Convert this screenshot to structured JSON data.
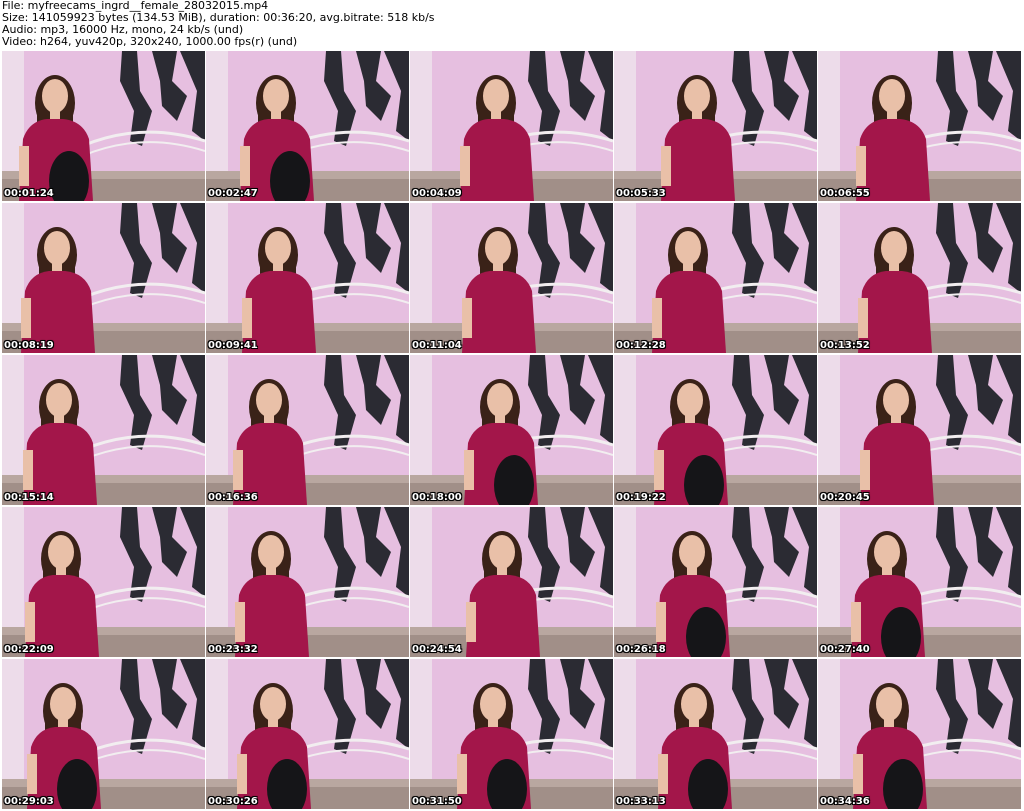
{
  "header": {
    "file": "File: myfreecams_ingrd__female_28032015.mp4",
    "size": "Size: 141059923 bytes (134.53 MiB), duration: 00:36:20, avg.bitrate: 518 kb/s",
    "audio": "Audio: mp3, 16000 Hz, mono, 24 kb/s (und)",
    "video": "Video: h264, yuv420p, 320x240, 1000.00 fps(r) (und)"
  },
  "frames": [
    {
      "timestamp": "00:01:24"
    },
    {
      "timestamp": "00:02:47"
    },
    {
      "timestamp": "00:04:09"
    },
    {
      "timestamp": "00:05:33"
    },
    {
      "timestamp": "00:06:55"
    },
    {
      "timestamp": "00:08:19"
    },
    {
      "timestamp": "00:09:41"
    },
    {
      "timestamp": "00:11:04"
    },
    {
      "timestamp": "00:12:28"
    },
    {
      "timestamp": "00:13:52"
    },
    {
      "timestamp": "00:15:14"
    },
    {
      "timestamp": "00:16:36"
    },
    {
      "timestamp": "00:18:00"
    },
    {
      "timestamp": "00:19:22"
    },
    {
      "timestamp": "00:20:45"
    },
    {
      "timestamp": "00:22:09"
    },
    {
      "timestamp": "00:23:32"
    },
    {
      "timestamp": "00:24:54"
    },
    {
      "timestamp": "00:26:18"
    },
    {
      "timestamp": "00:27:40"
    },
    {
      "timestamp": "00:29:03"
    },
    {
      "timestamp": "00:30:26"
    },
    {
      "timestamp": "00:31:50"
    },
    {
      "timestamp": "00:33:13"
    },
    {
      "timestamp": "00:34:36"
    }
  ],
  "colors": {
    "wall": "#e6bfe0",
    "shirt": "#a3164a",
    "hair": "#3a2218",
    "skin": "#e9c0a8",
    "decal": "#2b2b33",
    "bed": "#b9a7a0"
  }
}
